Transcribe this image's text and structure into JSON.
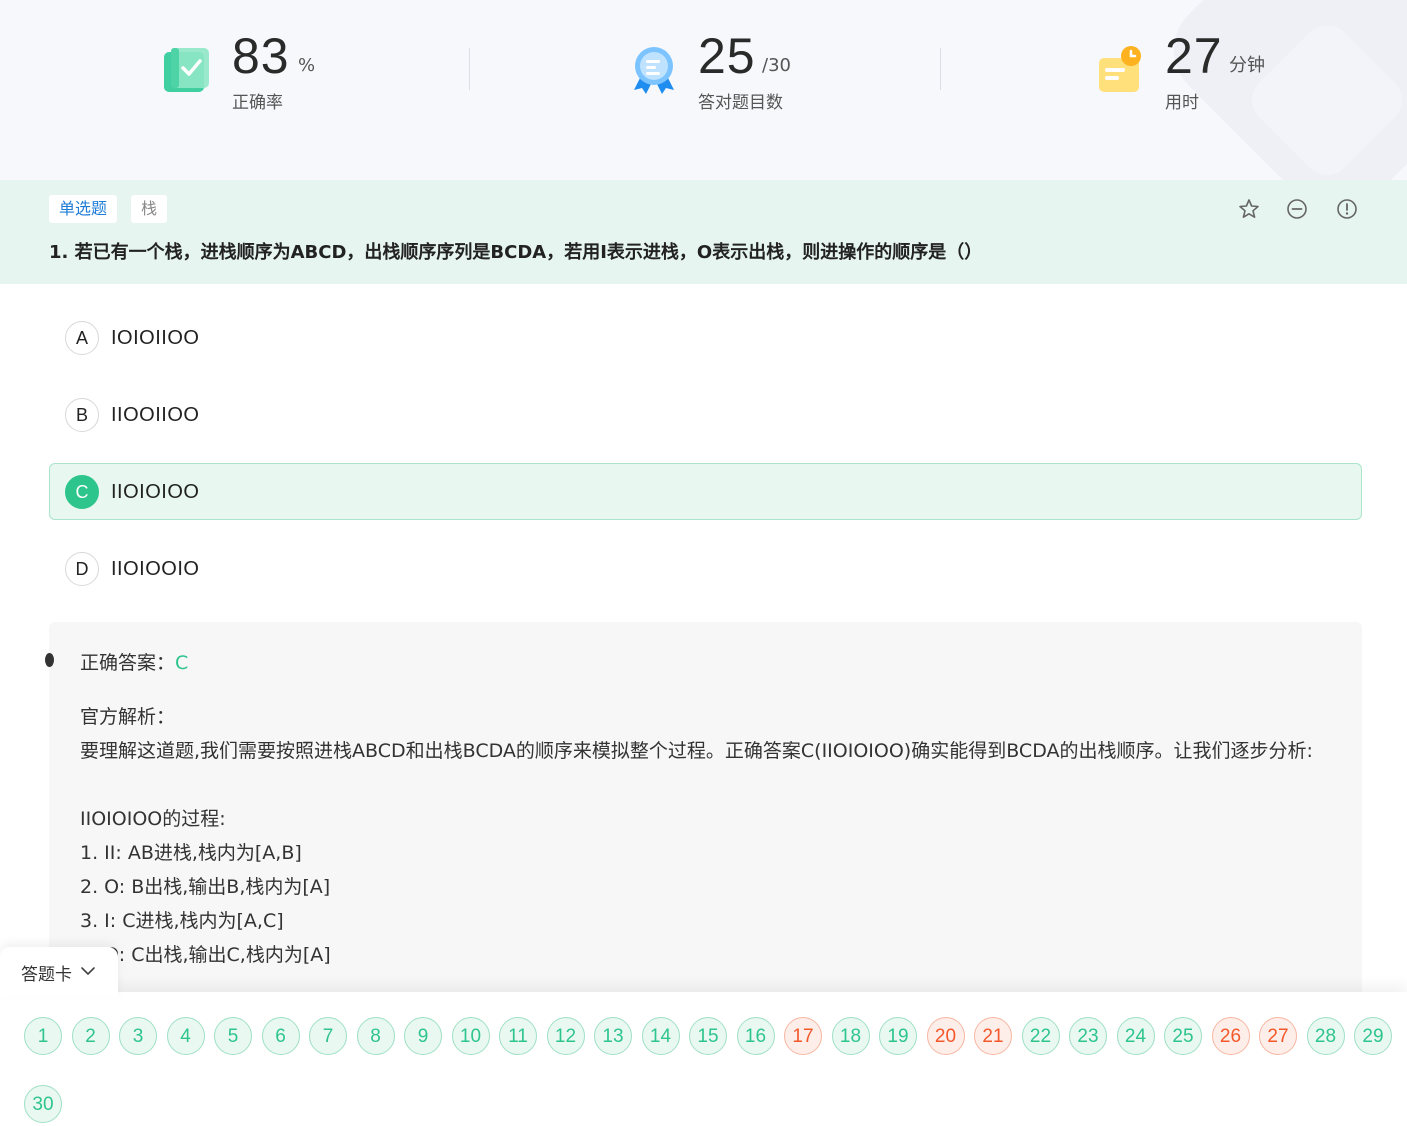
{
  "stats": [
    {
      "value": "83",
      "unit": "%",
      "label": "正确率"
    },
    {
      "value": "25",
      "unit": "/30",
      "label": "答对题目数"
    },
    {
      "value": "27",
      "unit": "分钟",
      "label": "用时"
    }
  ],
  "question": {
    "type_tag": "单选题",
    "topic_tag": "栈",
    "title": "1. 若已有一个栈，进栈顺序为ABCD，出栈顺序序列是BCDA，若用I表示进栈，O表示出栈，则进操作的顺序是（）",
    "options": [
      {
        "letter": "A",
        "text": "IOIOIIOO"
      },
      {
        "letter": "B",
        "text": "IIOOIIOO"
      },
      {
        "letter": "C",
        "text": "IIOIOIOO"
      },
      {
        "letter": "D",
        "text": "IIOIOOIO"
      }
    ],
    "selected": "C"
  },
  "analysis": {
    "answer_label": "正确答案：",
    "answer_value": "C",
    "explanation_title": "官方解析：",
    "explanation_body": "要理解这道题,我们需要按照进栈ABCD和出栈BCDA的顺序来模拟整个过程。正确答案C(IIOIOIOO)确实能得到BCDA的出栈顺序。让我们逐步分析:\n\nIIOIOIOO的过程:\n1. II: AB进栈,栈内为[A,B]\n2. O: B出栈,输出B,栈内为[A]\n3. I: C进栈,栈内为[A,C]\n4. O: C出栈,输出C,栈内为[A]"
  },
  "answer_card": {
    "toggle_label": "答题卡",
    "items": [
      {
        "n": "1",
        "status": "correct"
      },
      {
        "n": "2",
        "status": "correct"
      },
      {
        "n": "3",
        "status": "correct"
      },
      {
        "n": "4",
        "status": "correct"
      },
      {
        "n": "5",
        "status": "correct"
      },
      {
        "n": "6",
        "status": "correct"
      },
      {
        "n": "7",
        "status": "correct"
      },
      {
        "n": "8",
        "status": "correct"
      },
      {
        "n": "9",
        "status": "correct"
      },
      {
        "n": "10",
        "status": "correct"
      },
      {
        "n": "11",
        "status": "correct"
      },
      {
        "n": "12",
        "status": "correct"
      },
      {
        "n": "13",
        "status": "correct"
      },
      {
        "n": "14",
        "status": "correct"
      },
      {
        "n": "15",
        "status": "correct"
      },
      {
        "n": "16",
        "status": "correct"
      },
      {
        "n": "17",
        "status": "wrong"
      },
      {
        "n": "18",
        "status": "correct"
      },
      {
        "n": "19",
        "status": "correct"
      },
      {
        "n": "20",
        "status": "wrong"
      },
      {
        "n": "21",
        "status": "wrong"
      },
      {
        "n": "22",
        "status": "correct"
      },
      {
        "n": "23",
        "status": "correct"
      },
      {
        "n": "24",
        "status": "correct"
      },
      {
        "n": "25",
        "status": "correct"
      },
      {
        "n": "26",
        "status": "wrong"
      },
      {
        "n": "27",
        "status": "wrong"
      },
      {
        "n": "28",
        "status": "correct"
      },
      {
        "n": "29",
        "status": "correct"
      },
      {
        "n": "30",
        "status": "correct"
      }
    ]
  },
  "icons": {
    "accuracy": "check-book-icon",
    "correct_count": "award-medal-icon",
    "time": "clock-note-icon",
    "favorite": "star-outline-icon",
    "remove": "minus-circle-icon",
    "report": "alert-circle-icon",
    "collapse": "chevron-down-icon"
  },
  "colors": {
    "accent_green": "#2ec58c",
    "wrong_red": "#f2582a",
    "link_blue": "#1e7cd6",
    "header_bg": "#e6f5f0"
  }
}
